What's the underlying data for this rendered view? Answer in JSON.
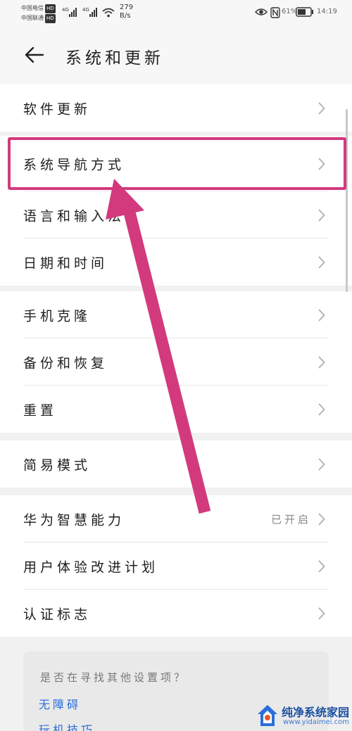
{
  "status_bar": {
    "carrier1": "中国电信",
    "carrier2": "中国联通",
    "hd_badge": "HD",
    "net_type": "4G",
    "speed_value": "279",
    "speed_unit": "B/s",
    "battery": "61%",
    "time": "14:19",
    "icons": [
      "eye-icon",
      "nfc-icon",
      "battery-icon",
      "wifi-icon",
      "signal-icon"
    ]
  },
  "header": {
    "back_icon": "arrow-left-icon",
    "title": "系统和更新"
  },
  "sections": [
    {
      "items": [
        {
          "label": "软件更新"
        }
      ]
    },
    {
      "items": [
        {
          "label": "系统导航方式",
          "highlighted": true
        },
        {
          "label": "语言和输入法"
        },
        {
          "label": "日期和时间"
        }
      ]
    },
    {
      "items": [
        {
          "label": "手机克隆"
        },
        {
          "label": "备份和恢复"
        },
        {
          "label": "重置"
        }
      ]
    },
    {
      "items": [
        {
          "label": "简易模式"
        }
      ]
    },
    {
      "items": [
        {
          "label": "华为智慧能力",
          "status": "已开启"
        },
        {
          "label": "用户体验改进计划"
        },
        {
          "label": "认证标志"
        }
      ]
    }
  ],
  "suggestions": {
    "question": "是否在寻找其他设置项？",
    "links": [
      "无障碍",
      "玩机技巧"
    ]
  },
  "annotation": {
    "color": "#d23a7d",
    "shape": "arrow pointing at highlighted row"
  },
  "watermark": {
    "title": "纯净系统家园",
    "url": "www.yidaimei.com"
  }
}
